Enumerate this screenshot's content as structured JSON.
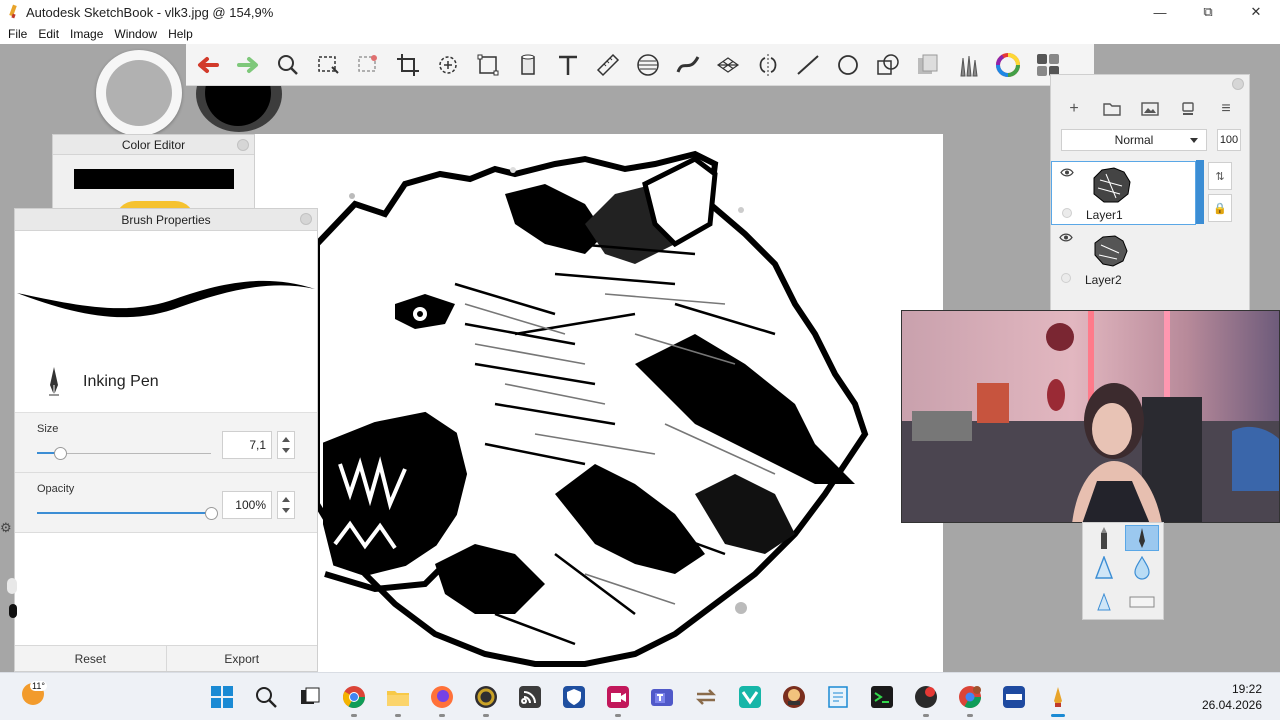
{
  "window": {
    "title": "Autodesk SketchBook - vlk3.jpg @ 154,9%",
    "controls": [
      "minimize-icon",
      "restore-icon",
      "close-icon"
    ]
  },
  "menu": [
    "File",
    "Edit",
    "Image",
    "Window",
    "Help"
  ],
  "toolbar": {
    "tools": [
      "undo-icon",
      "redo-icon",
      "zoom-icon",
      "select-icon",
      "lasso-select-icon",
      "crop-icon",
      "transform-icon",
      "distort-icon",
      "fill-icon",
      "text-icon",
      "ruler-icon",
      "ellipse-guide-icon",
      "french-curve-icon",
      "perspective-icon",
      "symmetry-icon",
      "line-icon",
      "ellipse-icon",
      "shape-icon",
      "copic-library-icon",
      "brush-library-icon",
      "color-wheel-icon",
      "palette-icon"
    ],
    "colors": {
      "undo": "#d23a2a",
      "redo": "#7ec87a"
    }
  },
  "color_editor": {
    "title": "Color Editor",
    "current_color": "#000000"
  },
  "brush_properties": {
    "title": "Brush Properties",
    "brush_name": "Inking Pen",
    "size": {
      "label": "Size",
      "value": "7,1",
      "fraction": 0.13
    },
    "opacity": {
      "label": "Opacity",
      "value": "100%",
      "fraction": 1.0
    },
    "reset_label": "Reset",
    "export_label": "Export"
  },
  "layers": {
    "blend_mode": "Normal",
    "opacity": "100",
    "items": [
      {
        "name": "Layer1",
        "selected": true
      },
      {
        "name": "Layer2",
        "selected": false
      }
    ]
  },
  "taskbar": {
    "weather_temp": "11°",
    "apps": [
      "windows-start-icon",
      "search-icon",
      "task-view-icon",
      "chrome-icon",
      "file-explorer-icon",
      "firefox-icon",
      "obs-icon",
      "rss-icon",
      "shield-icon",
      "camera-icon",
      "teams-icon",
      "sync-icon",
      "vpn-icon",
      "game-icon",
      "notepad-icon",
      "terminal-icon",
      "record-icon",
      "chrome-profile-icon",
      "ugee-icon",
      "sketchbook-icon"
    ],
    "time": "19:22",
    "date": "26.04.2026"
  }
}
